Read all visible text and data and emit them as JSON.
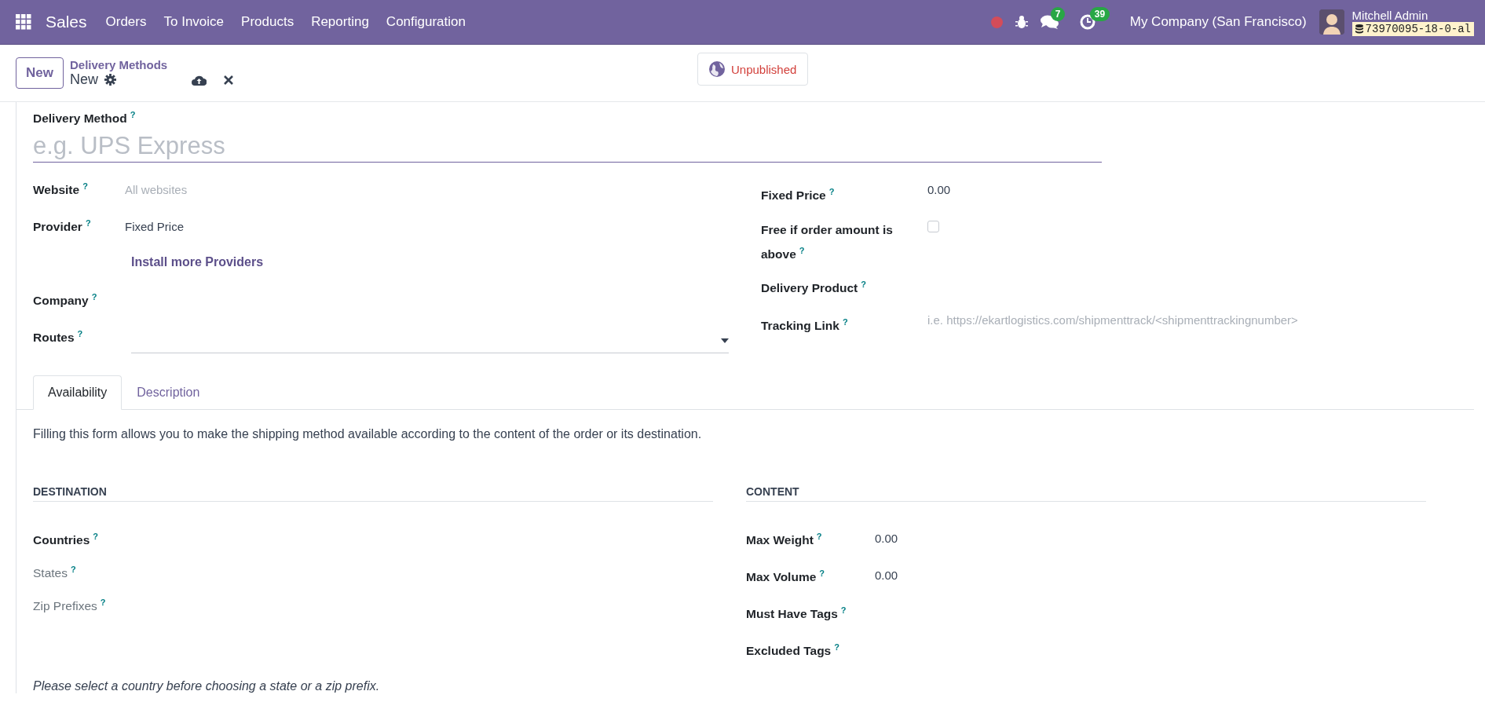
{
  "navbar": {
    "app_name": "Sales",
    "menu": [
      "Orders",
      "To Invoice",
      "Products",
      "Reporting",
      "Configuration"
    ],
    "messages_count": "7",
    "activities_count": "39",
    "company": "My Company (San Francisco)",
    "user_name": "Mitchell Admin",
    "database": "73970095-18-0-al"
  },
  "control_panel": {
    "new_button": "New",
    "breadcrumb": "Delivery Methods",
    "record_name": "New",
    "status_button": "Unpublished"
  },
  "form": {
    "title_field": {
      "label": "Delivery Method",
      "help": "?",
      "placeholder": "e.g. UPS Express"
    },
    "left_fields": [
      {
        "kind": "placeholder",
        "label": "Website",
        "help": "?",
        "placeholder": "All websites"
      },
      {
        "kind": "text",
        "label": "Provider",
        "help": "?",
        "value": "Fixed Price"
      },
      {
        "kind": "link",
        "text": "Install more Providers"
      },
      {
        "kind": "empty",
        "label": "Company",
        "help": "?"
      },
      {
        "kind": "dropdown",
        "label": "Routes",
        "help": "?"
      }
    ],
    "right_fields": [
      {
        "kind": "text",
        "label": "Fixed Price",
        "help": "?",
        "value": "0.00"
      },
      {
        "kind": "checkbox",
        "label": "Free if order amount is above",
        "help": "?",
        "checked": false
      },
      {
        "kind": "empty",
        "label": "Delivery Product",
        "help": "?"
      },
      {
        "kind": "placeholder",
        "label": "Tracking Link",
        "help": "?",
        "placeholder": "i.e. https://ekartlogistics.com/shipmenttrack/<shipmenttrackingnumber>"
      }
    ]
  },
  "tabs": [
    {
      "label": "Availability",
      "selected": true
    },
    {
      "label": "Description",
      "selected": false
    }
  ],
  "availability": {
    "intro": "Filling this form allows you to make the shipping method available according to the content of the order or its destination.",
    "sections": [
      {
        "title": "DESTINATION",
        "fields": [
          {
            "label": "Countries",
            "help": "?",
            "disabled": false
          },
          {
            "label": "States",
            "help": "?",
            "disabled": true
          },
          {
            "label": "Zip Prefixes",
            "help": "?",
            "disabled": true
          }
        ]
      },
      {
        "title": "CONTENT",
        "fields": [
          {
            "label": "Max Weight",
            "help": "?",
            "disabled": false,
            "value": "0.00"
          },
          {
            "label": "Max Volume",
            "help": "?",
            "disabled": false,
            "value": "0.00"
          },
          {
            "label": "Must Have Tags",
            "help": "?",
            "disabled": false
          },
          {
            "label": "Excluded Tags",
            "help": "?",
            "disabled": false
          }
        ]
      }
    ],
    "note": "Please select a country before choosing a state or a zip prefix."
  }
}
